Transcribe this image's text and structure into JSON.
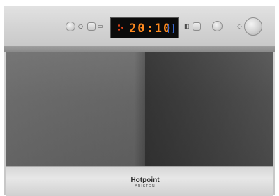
{
  "display": {
    "time": "20:10"
  },
  "brand": {
    "name": "Hotpoint",
    "sub": "ARISTON"
  },
  "icons": {
    "power_button": "power-icon",
    "defrost_button": "defrost-icon",
    "start_button": "start-icon",
    "dial": "selector-dial-icon"
  },
  "colors": {
    "display_digits": "#ff8a1f",
    "display_bg": "#0b0b0b",
    "indicator": "#3a6ad0"
  }
}
